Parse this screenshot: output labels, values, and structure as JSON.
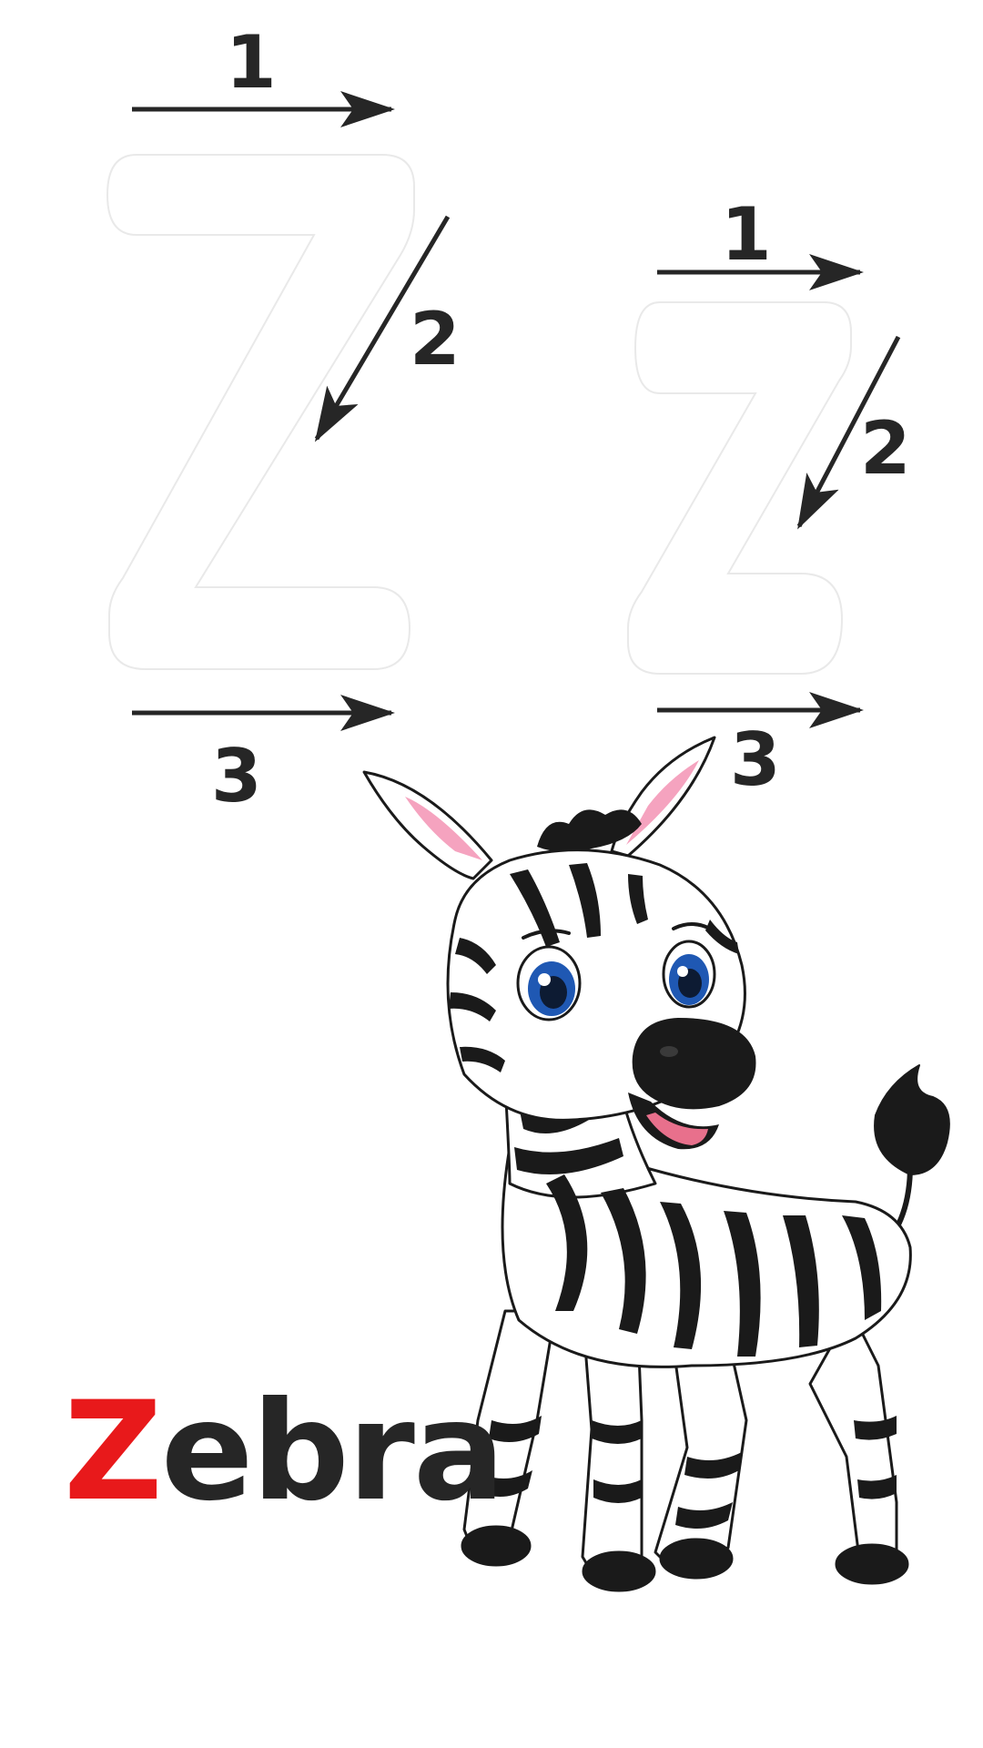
{
  "big_letter": {
    "letter": "Z",
    "steps": [
      "1",
      "2",
      "3"
    ]
  },
  "small_letter": {
    "letter": "z",
    "steps": [
      "1",
      "2",
      "3"
    ]
  },
  "word": {
    "first_letter": "Z",
    "rest": "ebra"
  },
  "picture": {
    "subject": "zebra"
  },
  "colors": {
    "accent": "#e8191b",
    "ink": "#262626",
    "stripe": "#1a1a1a",
    "ear_pink": "#f5a3bf",
    "eye_blue": "#1f58b3",
    "tongue": "#e8708c"
  }
}
